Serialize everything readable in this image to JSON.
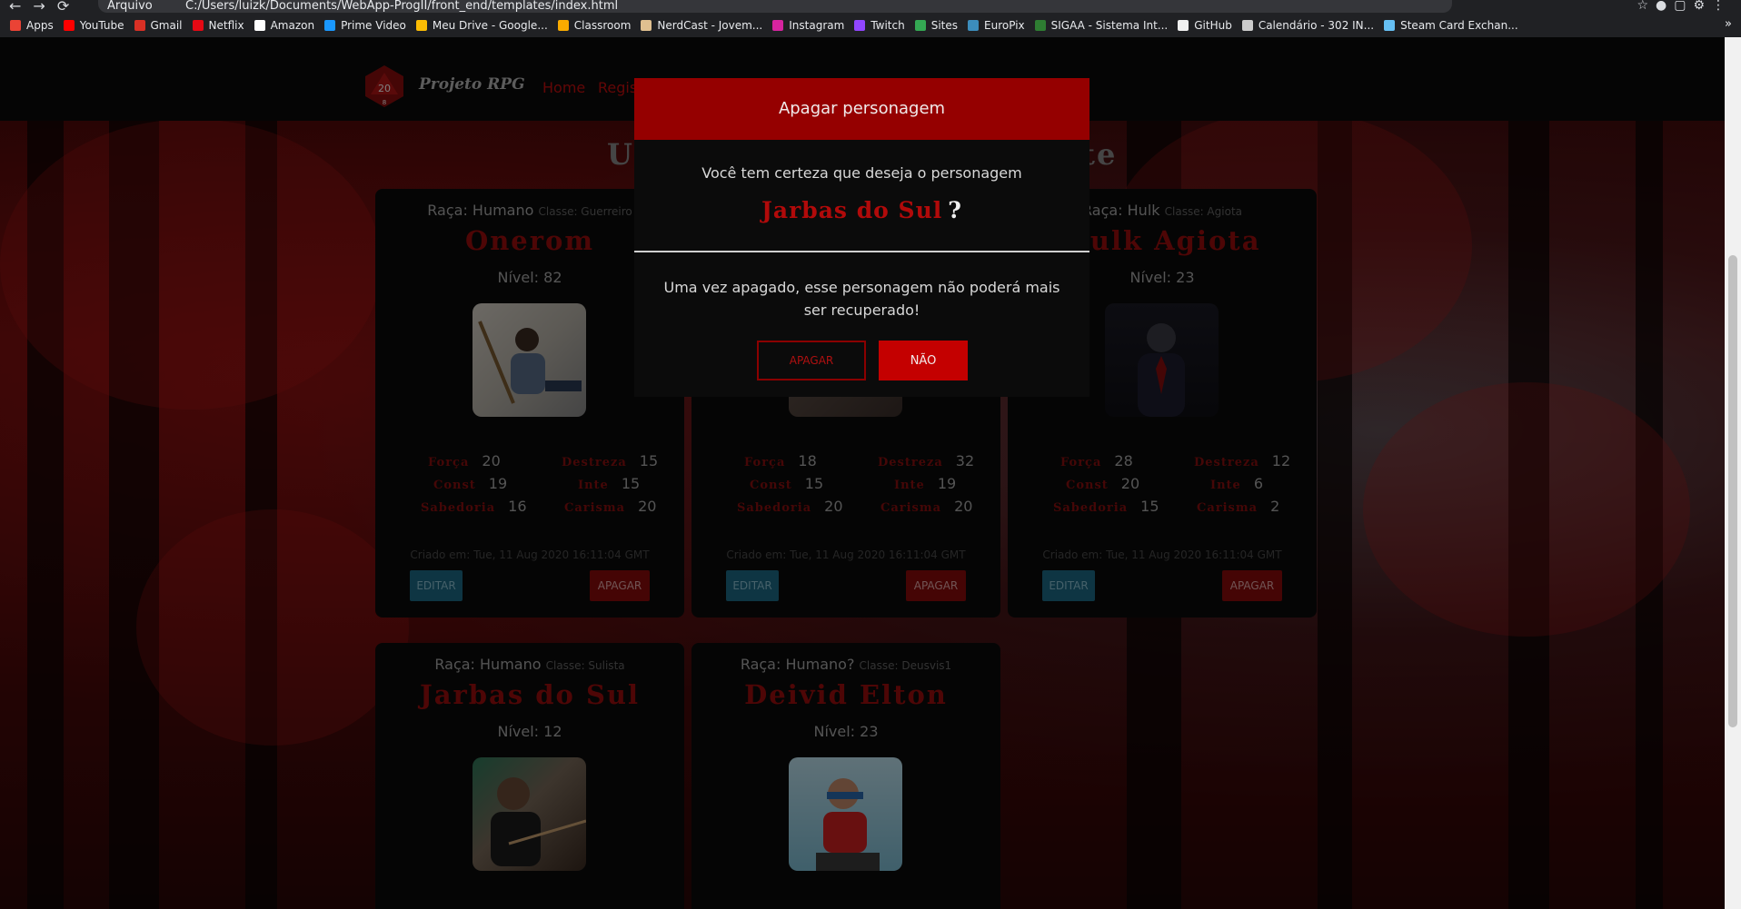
{
  "browser": {
    "url_scheme": "Arquivo",
    "url": "C:/Users/luizk/Documents/WebApp-ProgII/front_end/templates/index.html",
    "bookmarks": [
      {
        "label": "Apps",
        "color": "#ea4335"
      },
      {
        "label": "YouTube",
        "color": "#ff0000"
      },
      {
        "label": "Gmail",
        "color": "#d93025"
      },
      {
        "label": "Netflix",
        "color": "#e50914"
      },
      {
        "label": "Amazon",
        "color": "#ffffff"
      },
      {
        "label": "Prime Video",
        "color": "#1a98ff"
      },
      {
        "label": "Meu Drive - Google...",
        "color": "#fbbc04"
      },
      {
        "label": "Classroom",
        "color": "#f9ab00"
      },
      {
        "label": "NerdCast - Jovem...",
        "color": "#e0c090"
      },
      {
        "label": "Instagram",
        "color": "#d6249f"
      },
      {
        "label": "Twitch",
        "color": "#9146ff"
      },
      {
        "label": "Sites",
        "color": "#34a853"
      },
      {
        "label": "EuroPix",
        "color": "#3c8dbc"
      },
      {
        "label": "SIGAA - Sistema Int...",
        "color": "#2e7d32"
      },
      {
        "label": "GitHub",
        "color": "#f0f0f0"
      },
      {
        "label": "Calendário - 302 IN...",
        "color": "#cccccc"
      },
      {
        "label": "Steam Card Exchan...",
        "color": "#66c0f4"
      }
    ],
    "more": "»"
  },
  "navbar": {
    "die_number": "20",
    "die_bottom": "8",
    "brand": "Projeto RPG",
    "links": [
      "Home",
      "Regis"
    ]
  },
  "section_title_left": "Ul",
  "section_title_right": "ite",
  "cards": [
    {
      "race": "Raça: Humano",
      "class": "Classe: Guerreiro",
      "name": "Onerom",
      "level": "Nível: 82",
      "stats": {
        "forca": "20",
        "destreza": "15",
        "const": "19",
        "inte": "15",
        "sabedoria": "16",
        "carisma": "20"
      },
      "created": "Criado em: Tue, 11 Aug 2020 16:11:04 GMT"
    },
    {
      "race": "",
      "class": "",
      "name": "",
      "level": "",
      "stats": {
        "forca": "18",
        "destreza": "32",
        "const": "15",
        "inte": "19",
        "sabedoria": "20",
        "carisma": "20"
      },
      "created": "Criado em: Tue, 11 Aug 2020 16:11:04 GMT"
    },
    {
      "race": "Raça: Hulk",
      "class": "Classe: Agiota",
      "name": "Hulk Agiota",
      "level": "Nível: 23",
      "stats": {
        "forca": "28",
        "destreza": "12",
        "const": "20",
        "inte": "6",
        "sabedoria": "15",
        "carisma": "2"
      },
      "created": "Criado em: Tue, 11 Aug 2020 16:11:04 GMT"
    },
    {
      "race": "Raça: Humano",
      "class": "Classe: Sulista",
      "name": "Jarbas do Sul",
      "level": "Nível: 12"
    },
    {
      "race": "Raça: Humano?",
      "class": "Classe: Deusvis1",
      "name": "Deivid Elton",
      "level": "Nível: 23"
    }
  ],
  "stat_labels": {
    "forca": "Força",
    "destreza": "Destreza",
    "const": "Const",
    "inte": "Inte",
    "sabedoria": "Sabedoria",
    "carisma": "Carisma"
  },
  "buttons": {
    "edit": "EDITAR",
    "delete": "APAGAR"
  },
  "modal": {
    "title": "Apagar personagem",
    "question": "Você tem certeza que deseja o personagem",
    "character": "Jarbas do Sul",
    "question_mark": "?",
    "warning": "Uma vez apagado, esse personagem não poderá mais ser recuperado!",
    "confirm": "APAGAR",
    "cancel": "NÃO"
  },
  "colors": {
    "accent": "#950000",
    "brand_red": "#c40d0d",
    "edit_blue": "#1c6a86"
  }
}
